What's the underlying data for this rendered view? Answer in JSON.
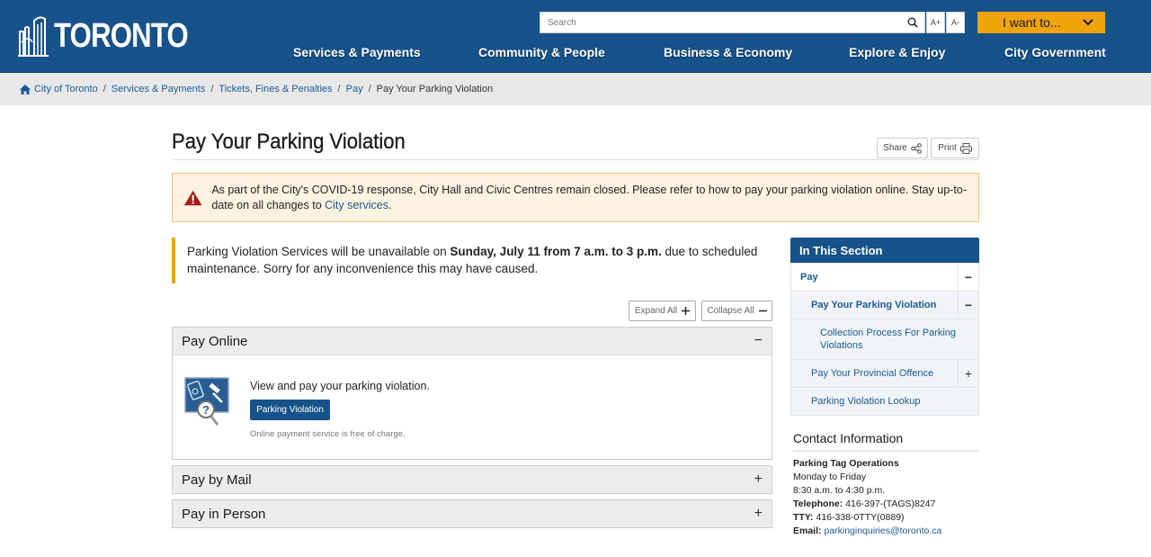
{
  "header": {
    "logo_text": "TORONTO",
    "search_placeholder": "Search",
    "font_increase": "A+",
    "font_decrease": "A-",
    "i_want_to": "I want to...",
    "nav": [
      {
        "label": "Services & Payments"
      },
      {
        "label": "Community & People"
      },
      {
        "label": "Business & Economy"
      },
      {
        "label": "Explore & Enjoy"
      },
      {
        "label": "City Government"
      }
    ]
  },
  "breadcrumb": {
    "items": [
      "City of Toronto",
      "Services & Payments",
      "Tickets, Fines & Penalties",
      "Pay"
    ],
    "current": "Pay Your Parking Violation",
    "separator": "/"
  },
  "page": {
    "title": "Pay Your Parking Violation",
    "share_label": "Share",
    "print_label": "Print"
  },
  "alert": {
    "text_before": "As part of the City's COVID-19 response, City Hall and Civic Centres remain closed. Please refer to how to pay your parking violation online. Stay up-to-date on all changes to ",
    "link": "City services",
    "text_after": "."
  },
  "notice": {
    "text1": "Parking Violation Services will be unavailable on ",
    "bold": "Sunday, July 11 from 7 a.m. to 3 p.m.",
    "text2": " due to scheduled maintenance. Sorry for any inconvenience this may have caused."
  },
  "controls": {
    "expand_all": "Expand All",
    "collapse_all": "Collapse All"
  },
  "accordions": [
    {
      "title": "Pay Online",
      "toggle": "−",
      "description": "View and pay your parking violation.",
      "button": "Parking Violation",
      "note": "Online payment service is free of charge."
    },
    {
      "title": "Pay by Mail",
      "toggle": "+"
    },
    {
      "title": "Pay in Person",
      "toggle": "+"
    }
  ],
  "sidebar": {
    "heading": "In This Section",
    "items": [
      {
        "label": "Pay",
        "toggle": "−"
      },
      {
        "label": "Pay Your Parking Violation",
        "toggle": "−"
      },
      {
        "label": "Collection Process For Parking Violations"
      },
      {
        "label": "Pay Your Provincial Offence",
        "toggle": "+"
      },
      {
        "label": "Parking Violation Lookup"
      }
    ]
  },
  "contact": {
    "heading": "Contact Information",
    "org": "Parking Tag Operations",
    "days": "Monday to Friday",
    "hours": "8:30 a.m. to 4:30 p.m.",
    "telephone_label": "Telephone:",
    "telephone": "416-397-(TAGS)8247",
    "tty_label": "TTY:",
    "tty": "416-338-0TTY(0889)",
    "email_label": "Email:",
    "email": "parkinginquiries@toronto.ca"
  },
  "colors": {
    "brand_blue": "#17528a",
    "accent_orange": "#f0a30a",
    "alert_bg": "#fdf3e0",
    "alert_icon": "#a51c1c",
    "link": "#1d5a93"
  }
}
